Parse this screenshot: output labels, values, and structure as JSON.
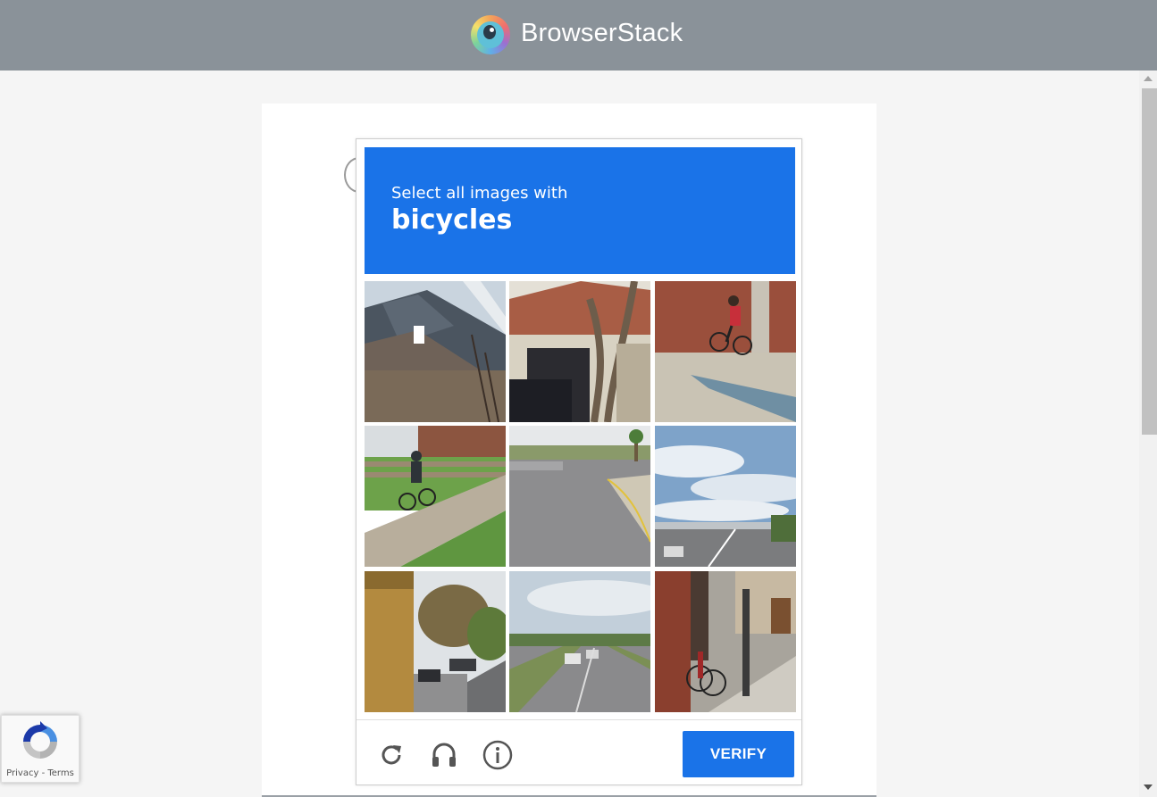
{
  "brand": {
    "name": "BrowserStack",
    "icon": "browserstack-eye-icon",
    "topbar_color": "#8a9299"
  },
  "captcha": {
    "instruction": "Select all images with",
    "target": "bicycles",
    "accent_color": "#1a73e8",
    "tiles": [
      {
        "scene": "house-roof"
      },
      {
        "scene": "garage-with-tree"
      },
      {
        "scene": "cyclist-by-brick-wall"
      },
      {
        "scene": "cyclist-on-path-by-fence"
      },
      {
        "scene": "road-intersection"
      },
      {
        "scene": "highway-overpass-sky"
      },
      {
        "scene": "street-with-trees"
      },
      {
        "scene": "highway-traffic"
      },
      {
        "scene": "bicycle-on-sidewalk"
      }
    ],
    "controls": {
      "reload_icon": "reload-icon",
      "audio_icon": "headphones-icon",
      "info_icon": "info-icon"
    },
    "verify_label": "VERIFY"
  },
  "recaptcha_badge": {
    "icon": "recaptcha-logo-icon",
    "privacy": "Privacy",
    "separator": " - ",
    "terms": "Terms"
  }
}
